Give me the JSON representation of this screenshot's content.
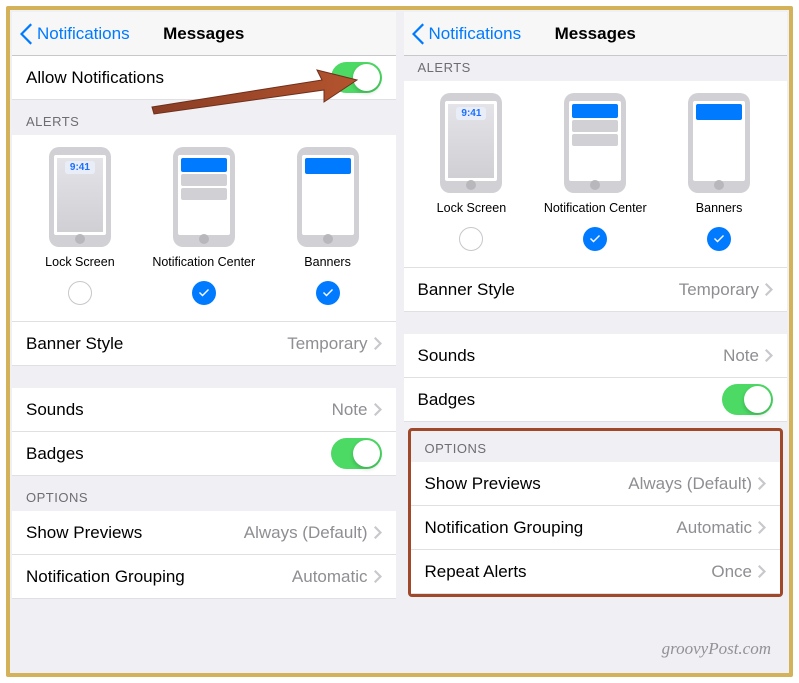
{
  "nav": {
    "back_label": "Notifications",
    "title": "Messages"
  },
  "allow_row": {
    "label": "Allow Notifications"
  },
  "sections": {
    "alerts": "ALERTS",
    "options": "OPTIONS"
  },
  "alerts": {
    "lock_time": "9:41",
    "lock_label": "Lock Screen",
    "center_label": "Notification Center",
    "banners_label": "Banners",
    "lock_checked": false,
    "center_checked": true,
    "banners_checked": true
  },
  "rows": {
    "banner_style": {
      "label": "Banner Style",
      "value": "Temporary"
    },
    "sounds": {
      "label": "Sounds",
      "value": "Note"
    },
    "badges": {
      "label": "Badges"
    },
    "show_previews": {
      "label": "Show Previews",
      "value": "Always (Default)"
    },
    "notification_grouping": {
      "label": "Notification Grouping",
      "value": "Automatic"
    },
    "repeat_alerts": {
      "label": "Repeat Alerts",
      "value": "Once"
    }
  },
  "watermark": "groovyPost.com",
  "colors": {
    "accent": "#007aff",
    "toggle_on": "#4cd964",
    "annotation": "#a0482a"
  }
}
